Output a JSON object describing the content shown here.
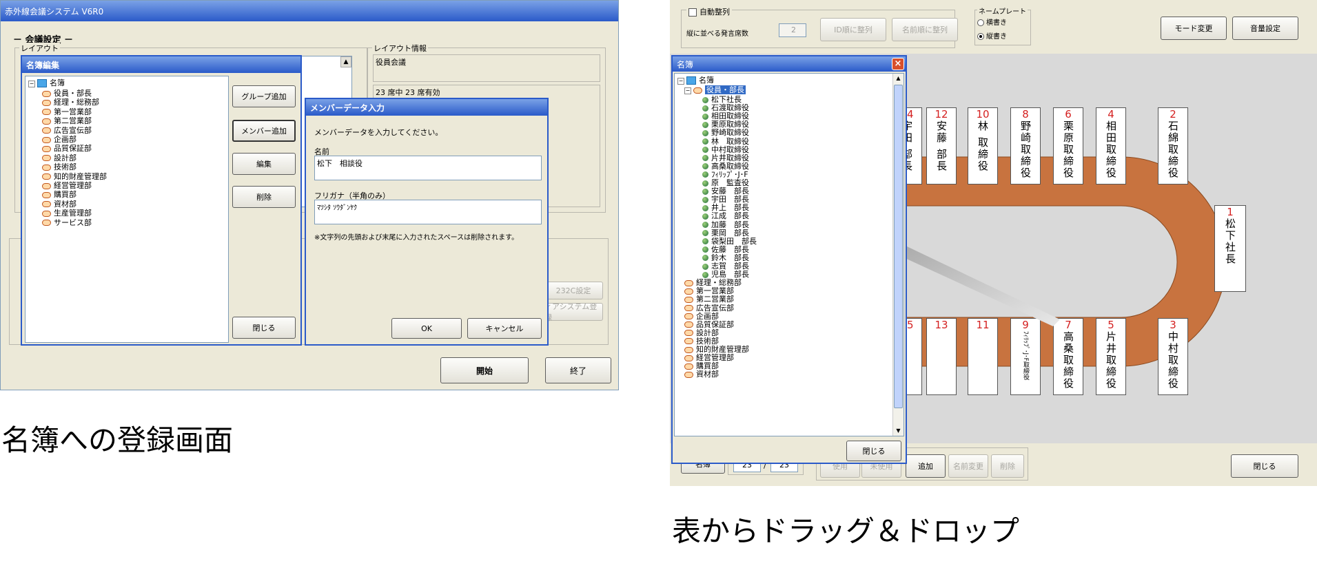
{
  "left_window": {
    "title": "赤外線会議システム V6R0",
    "section_title": "－ 会議設定 －",
    "layout_label": "レイアウト",
    "layout_info_label": "レイアウト情報",
    "layout_info_value": "役員会議",
    "layout_info_detail": "23 席中 23 席有効",
    "btn_rs232c": "232C設定",
    "btn_system_register": "ィアシステム登録",
    "btn_start": "開始",
    "btn_end": "終了"
  },
  "roster_editor": {
    "title": "名簿編集",
    "root": "名簿",
    "departments": [
      "役員・部長",
      "経理・総務部",
      "第一営業部",
      "第二営業部",
      "広告宣伝部",
      "企画部",
      "品質保証部",
      "設計部",
      "技術部",
      "知的財産管理部",
      "経営管理部",
      "購買部",
      "資材部",
      "生産管理部",
      "サービス部"
    ],
    "btn_add_group": "グループ追加",
    "btn_add_member": "メンバー追加",
    "btn_edit": "編集",
    "btn_delete": "削除",
    "btn_close": "閉じる"
  },
  "member_dialog": {
    "title": "メンバーデータ入力",
    "prompt": "メンバーデータを入力してください。",
    "name_label": "名前",
    "name_value": "松下　相談役",
    "kana_label": "フリガナ（半角のみ）",
    "kana_value": "ﾏﾂｼﾀ ｿｳﾀﾞﾝﾔｸ",
    "note": "※文字列の先頭および末尾に入力されたスペースは削除されます。",
    "btn_ok": "OK",
    "btn_cancel": "キャンセル"
  },
  "right_window": {
    "auto_arrange_label": "自動整列",
    "per_row_label": "縦に並べる発言席数",
    "per_row_value": "2",
    "btn_by_id": "ID順に整列",
    "btn_by_name": "名前順に整列",
    "nameplate_label": "ネームプレート",
    "radio_horizontal": "横書き",
    "radio_vertical": "縦書き",
    "btn_mode_change": "モード変更",
    "btn_volume": "音量設定",
    "btn_roster": "名簿",
    "count_current": "23",
    "count_sep": "/",
    "count_total": "23",
    "btn_use": "使用",
    "btn_unuse": "未使用",
    "btn_add": "追加",
    "btn_rename": "名前変更",
    "btn_delete": "削除",
    "btn_close": "閉じる"
  },
  "roster_panel": {
    "title": "名簿",
    "root": "名簿",
    "selected_group": "役員・部長",
    "members": [
      "松下社長",
      "石渡取締役",
      "相田取締役",
      "栗原取締役",
      "野崎取締役",
      "林　取締役",
      "中村取締役",
      "片井取締役",
      "高桑取締役",
      "ﾌｨﾘｯﾌﾟ･J･F",
      "原　監査役",
      "安藤　部長",
      "宇田　部長",
      "井上　部長",
      "江成　部長",
      "加藤　部長",
      "栗岡　部長",
      "袋梨田　部長",
      "佐藤　部長",
      "鈴木　部長",
      "志賀　部長",
      "児島　部長"
    ],
    "departments": [
      "経理・総務部",
      "第一営業部",
      "第二営業部",
      "広告宣伝部",
      "企画部",
      "品質保証部",
      "設計部",
      "技術部",
      "知的財産管理部",
      "経営管理部",
      "購買部",
      "資材部"
    ],
    "btn_close": "閉じる"
  },
  "seats_top": [
    {
      "num": "14",
      "name": "宇田 部長"
    },
    {
      "num": "12",
      "name": "安藤 部長"
    },
    {
      "num": "10",
      "name": "林 取締役"
    },
    {
      "num": "8",
      "name": "野崎取締役"
    },
    {
      "num": "6",
      "name": "栗原取締役"
    },
    {
      "num": "4",
      "name": "相田取締役"
    },
    {
      "num": "2",
      "name": "石綿取締役"
    }
  ],
  "seats_bottom": [
    {
      "num": "15",
      "name": ""
    },
    {
      "num": "13",
      "name": ""
    },
    {
      "num": "11",
      "name": ""
    },
    {
      "num": "9",
      "name": "ﾌｨﾘｯﾌﾟ･J･F取締役"
    },
    {
      "num": "7",
      "name": "高桑取締役"
    },
    {
      "num": "5",
      "name": "片井取締役"
    },
    {
      "num": "3",
      "name": "中村取締役"
    }
  ],
  "seat_head": {
    "num": "1",
    "name": "松下社長"
  },
  "captions": {
    "left": "名簿への登録画面",
    "right": "表からドラッグ＆ドロップ"
  },
  "colors": {
    "xp_blue": "#0a246a",
    "title_blue": "#2a5ac9",
    "table_wood": "#c8733f",
    "seat_number_red": "#d42020"
  }
}
